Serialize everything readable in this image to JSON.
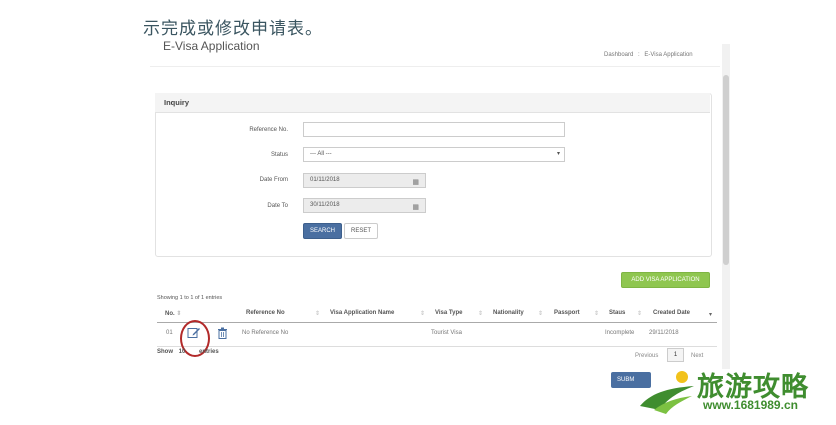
{
  "caption": "示完成或修改申请表。",
  "page": {
    "title": "E-Visa Application"
  },
  "breadcrumb": {
    "home": "Dashboard",
    "sep": ":",
    "current": "E-Visa Application"
  },
  "inquiry": {
    "title": "Inquiry",
    "reference_label": "Reference No.",
    "reference_value": "",
    "status_label": "Status",
    "status_value": "--- All ---",
    "date_from_label": "Date From",
    "date_from_value": "01/11/2018",
    "date_to_label": "Date To",
    "date_to_value": "30/11/2018",
    "search_label": "SEARCH",
    "reset_label": "RESET"
  },
  "add_button": "ADD VISA APPLICATION",
  "table": {
    "info": "Showing 1 to 1 of 1 entries",
    "columns": [
      "No.",
      "Reference No",
      "Visa Application Name",
      "Visa Type",
      "Nationality",
      "Passport",
      "Staus",
      "Created Date"
    ],
    "rows": [
      {
        "no": "01",
        "reference": "No Reference No",
        "name": "",
        "type": "Tourist Visa",
        "nationality": "",
        "passport": "",
        "status": "Incomplete",
        "created": "29/11/2018"
      }
    ],
    "show_label": "Show",
    "show_value": "10",
    "entries_label": "entries"
  },
  "pagination": {
    "previous": "Previous",
    "current": "1",
    "next": "Next"
  },
  "submit_label": "SUBM",
  "watermark": {
    "text": "旅游攻略",
    "url": "www.1681989.cn"
  },
  "colors": {
    "primary": "#4a6fa1",
    "add": "#8fc650",
    "highlight": "#b22a2a",
    "watermark": "#3f8d2f"
  }
}
